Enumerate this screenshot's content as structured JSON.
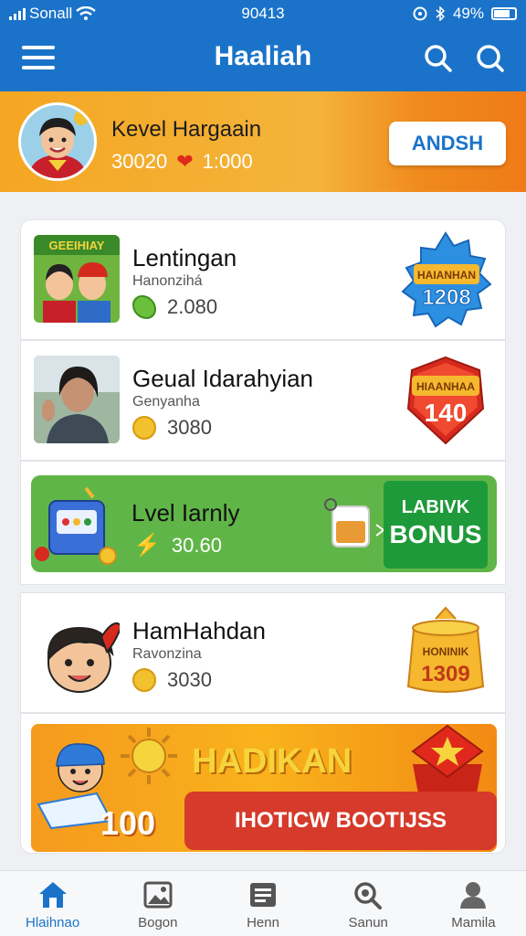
{
  "status_bar": {
    "carrier": "Sonall",
    "time": "90413",
    "battery": "49%"
  },
  "app_bar": {
    "title": "Haaliah"
  },
  "profile": {
    "name": "Kevel Hargaain",
    "points": "30020",
    "lives": "1:000",
    "button_label": "ANDSH"
  },
  "cards": [
    {
      "title": "Lentingan",
      "subtitle": "Hanonzihá",
      "value": "2.080",
      "badge": "HAIANHAN",
      "badge_value": "1208"
    },
    {
      "title": "Geual Idarahyian",
      "subtitle": "Genyanha",
      "value": "3080",
      "badge": "HIAANHAA",
      "badge_value": "140"
    },
    {
      "title": "Lvel Iarnly",
      "value": "30.60",
      "button_line1": "LABIVK",
      "button_line2": "BONUS"
    },
    {
      "title": "HamHahdan",
      "subtitle": "Ravonzina",
      "value": "3030",
      "badge": "HONINIK",
      "badge_value": "1309"
    }
  ],
  "thumb_text": "GEEIHIAY",
  "promo": {
    "title": "HADIKAN",
    "number": "100",
    "button_label": "IHOTICW BOOTIJSS"
  },
  "nav": [
    {
      "label": "Hlaihnao",
      "icon": "home-icon",
      "active": true
    },
    {
      "label": "Bogon",
      "icon": "gallery-icon",
      "active": false
    },
    {
      "label": "Henn",
      "icon": "list-icon",
      "active": false
    },
    {
      "label": "Sanun",
      "icon": "search-icon",
      "active": false
    },
    {
      "label": "Mamila",
      "icon": "person-icon",
      "active": false
    }
  ],
  "colors": {
    "primary": "#1a73c9",
    "banner": "#f5a623",
    "green_card": "#60b548",
    "promo_button": "#d63a2a"
  }
}
